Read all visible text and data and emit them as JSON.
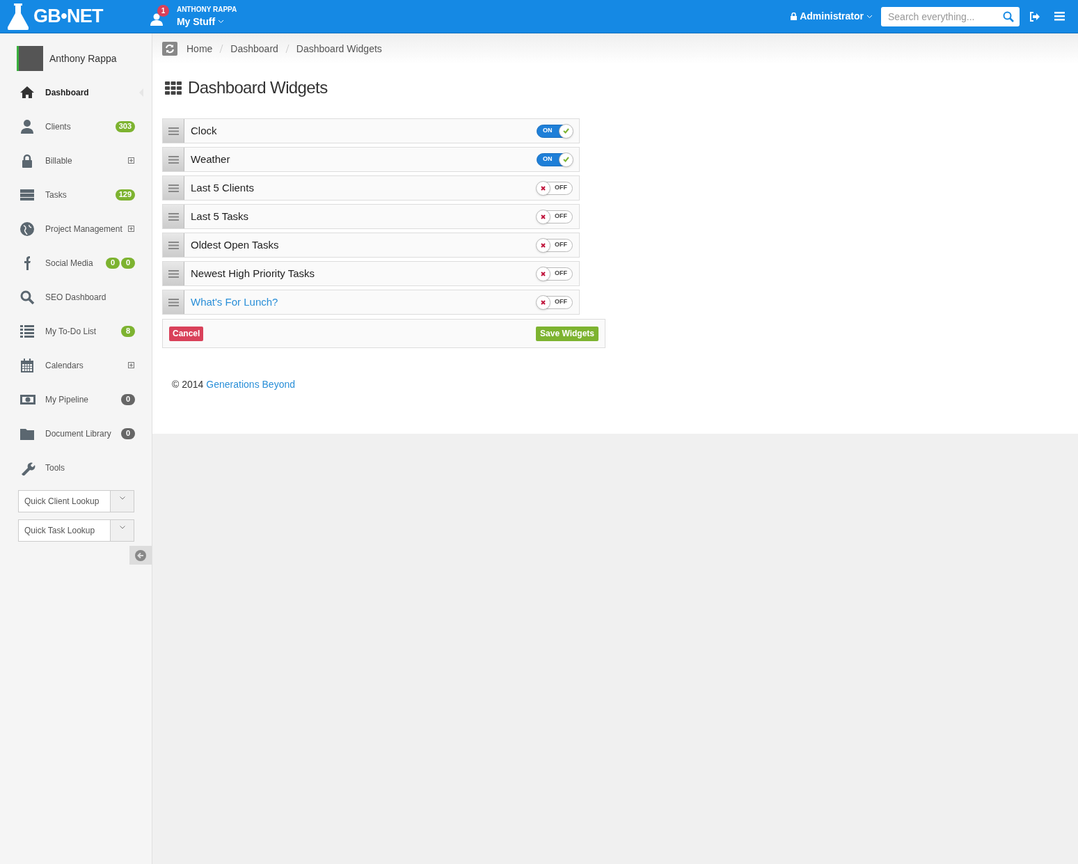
{
  "topbar": {
    "logo": "GB•NET",
    "notifications": "1",
    "user_caption": "ANTHONY RAPPA",
    "menu": "My Stuff",
    "role": "Administrator",
    "search": {
      "placeholder": "Search everything..."
    }
  },
  "sidebar": {
    "user": "Anthony Rappa",
    "items": [
      {
        "label": "Dashboard",
        "selected": true,
        "expandable": false
      },
      {
        "label": "Clients",
        "selected": false,
        "expandable": false,
        "badges": [
          {
            "text": "303",
            "kind": "green"
          }
        ]
      },
      {
        "label": "Billable",
        "selected": false,
        "expandable": true
      },
      {
        "label": "Tasks",
        "selected": false,
        "expandable": false,
        "badges": [
          {
            "text": "129",
            "kind": "green"
          }
        ]
      },
      {
        "label": "Project Management",
        "selected": false,
        "expandable": true
      },
      {
        "label": "Social Media",
        "selected": false,
        "expandable": false,
        "badges": [
          {
            "text": "0",
            "kind": "green"
          },
          {
            "text": "0",
            "kind": "green"
          }
        ]
      },
      {
        "label": "SEO Dashboard",
        "selected": false,
        "expandable": false
      },
      {
        "label": "My To-Do List",
        "selected": false,
        "expandable": false,
        "badges": [
          {
            "text": "8",
            "kind": "green"
          }
        ]
      },
      {
        "label": "Calendars",
        "selected": false,
        "expandable": true
      },
      {
        "label": "My Pipeline",
        "selected": false,
        "expandable": false,
        "badges": [
          {
            "text": "0",
            "kind": "gray"
          }
        ]
      },
      {
        "label": "Document Library",
        "selected": false,
        "expandable": false,
        "badges": [
          {
            "text": "0",
            "kind": "gray"
          }
        ]
      },
      {
        "label": "Tools",
        "selected": false,
        "expandable": false
      }
    ],
    "lookups": [
      "Quick Client Lookup",
      "Quick Task Lookup"
    ]
  },
  "breadcrumb": [
    "Home",
    "Dashboard",
    "Dashboard Widgets"
  ],
  "title": "Dashboard Widgets",
  "widgets": [
    {
      "label": "Clock",
      "on": true,
      "switch_label": "ON",
      "linked": false
    },
    {
      "label": "Weather",
      "on": true,
      "switch_label": "ON",
      "linked": false
    },
    {
      "label": "Last 5 Clients",
      "on": false,
      "switch_label": "OFF",
      "linked": false
    },
    {
      "label": "Last 5 Tasks",
      "on": false,
      "switch_label": "OFF",
      "linked": false
    },
    {
      "label": "Oldest Open Tasks",
      "on": false,
      "switch_label": "OFF",
      "linked": false
    },
    {
      "label": "Newest High Priority Tasks",
      "on": false,
      "switch_label": "OFF",
      "linked": false
    },
    {
      "label": "What's For Lunch?",
      "on": false,
      "switch_label": "OFF",
      "linked": true
    }
  ],
  "buttons": {
    "cancel": "Cancel",
    "save": "Save Widgets"
  },
  "footer": {
    "copyright": "© 2014",
    "link": "Generations Beyond"
  }
}
